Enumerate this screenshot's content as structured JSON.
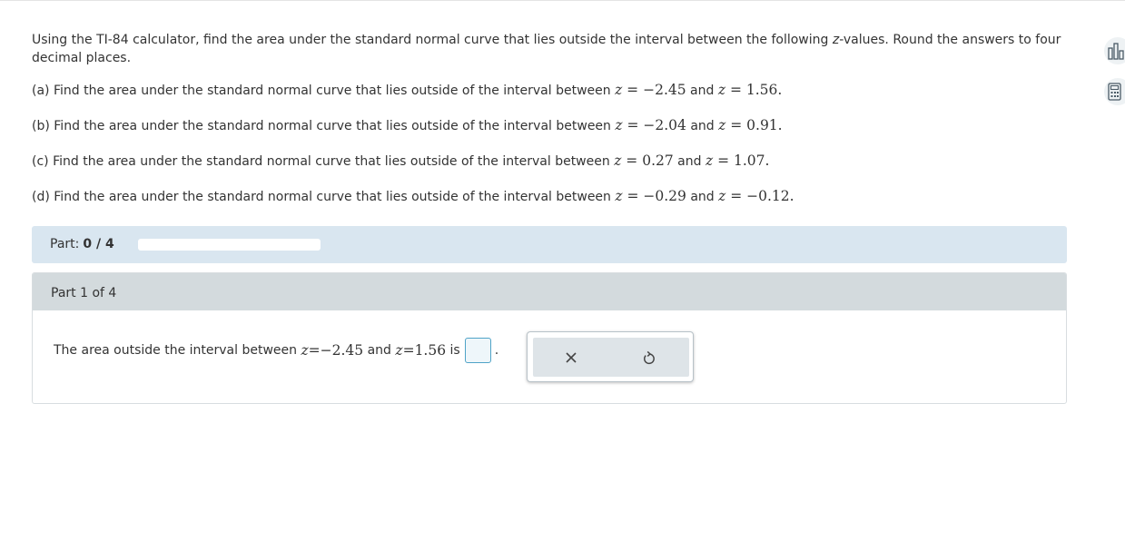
{
  "intro": {
    "before": "Using the TI-84 calculator, find the area under the standard normal curve that lies outside the interval between the following ",
    "z": "z",
    "after": "-values. Round the answers to four decimal places."
  },
  "questions": [
    {
      "label": "(a)",
      "text": "Find the area under the standard normal curve that lies outside of the interval between",
      "z1": "−2.45",
      "z2": "1.56"
    },
    {
      "label": "(b)",
      "text": "Find the area under the standard normal curve that lies outside of the interval between",
      "z1": "−2.04",
      "z2": "0.91"
    },
    {
      "label": "(c)",
      "text": "Find the area under the standard normal curve that lies outside of the interval between",
      "z1": "0.27",
      "z2": "1.07"
    },
    {
      "label": "(d)",
      "text": "Find the area under the standard normal curve that lies outside of the interval between",
      "z1": "−0.29",
      "z2": "−0.12"
    }
  ],
  "math": {
    "z": "z",
    "eq": " = ",
    "and": "and",
    "period": "."
  },
  "progress": {
    "label": "Part:",
    "value": "0 / 4",
    "fraction": 0
  },
  "part": {
    "header": "Part 1 of 4",
    "answer_prefix": "The area outside the interval between",
    "z1": "−2.45",
    "z2": "1.56",
    "is": "is",
    "period": ".",
    "input_value": ""
  },
  "tools": {
    "clear_icon": "close-icon",
    "reset_icon": "undo-icon"
  },
  "side": {
    "top_icon": "bar-chart-icon",
    "bottom_icon": "calculator-icon"
  },
  "colors": {
    "accent": "#2a7d9c",
    "progress_bg": "#d9e6f0",
    "part_header_bg": "#d3dadd"
  }
}
